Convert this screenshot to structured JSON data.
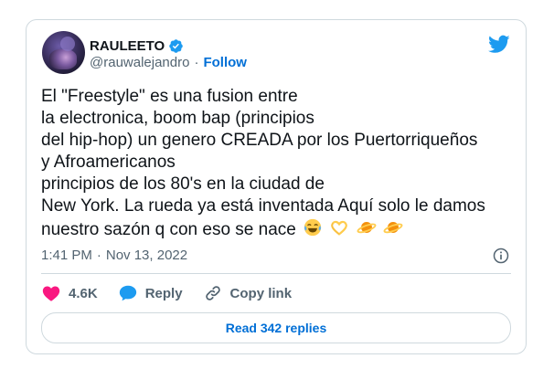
{
  "tweet": {
    "display_name": "RAULEETO",
    "handle": "@rauwalejandro",
    "separator": "·",
    "follow_label": "Follow",
    "text_lines": [
      "El \"Freestyle\" es una fusion entre",
      "la electronica, boom bap (principios",
      "del hip-hop) un genero CREADA por los Puertorriqueños",
      "y Afroamericanos",
      "principios de los 80's en la ciudad de",
      "New York. La rueda ya está inventada Aquí solo le damos",
      "nuestro sazón q con eso se nace"
    ],
    "emojis": [
      "😂",
      "🫶",
      "🪐",
      "🪐"
    ],
    "time": "1:41 PM",
    "date_separator": "·",
    "date": "Nov 13, 2022"
  },
  "actions": {
    "likes_count": "4.6K",
    "reply_label": "Reply",
    "copy_link_label": "Copy link"
  },
  "read_replies_label": "Read 342 replies",
  "colors": {
    "link_blue": "#006fd6",
    "twitter_blue": "#1d9bf0",
    "like_red": "#f91880",
    "muted_gray": "#536471",
    "border": "#cfd9de"
  },
  "icons": [
    "verified-badge-icon",
    "twitter-bird-icon",
    "info-icon",
    "heart-icon",
    "reply-bubble-icon",
    "link-icon"
  ]
}
